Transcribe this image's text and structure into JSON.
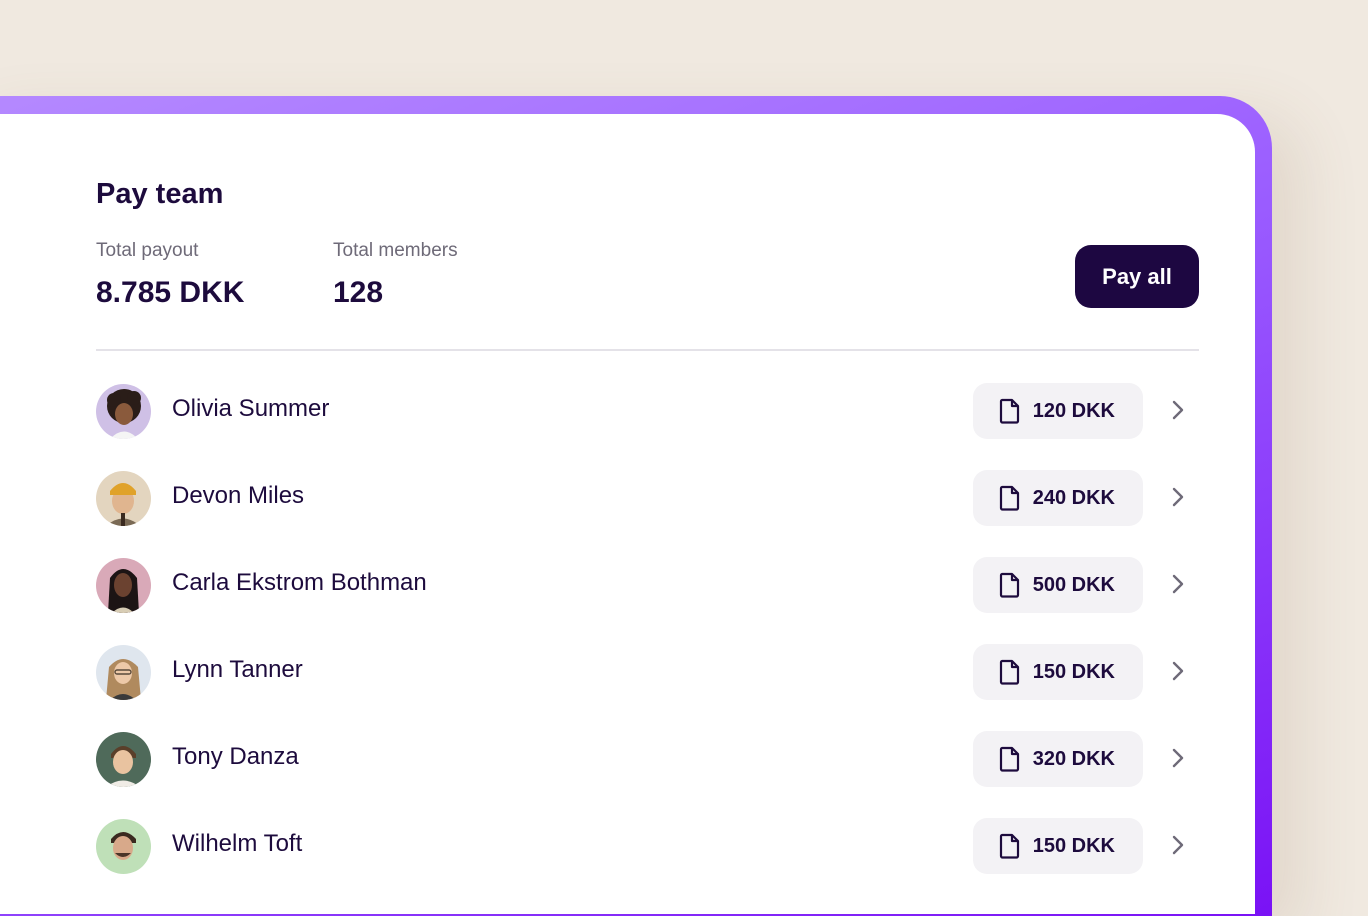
{
  "header": {
    "title": "Pay team",
    "pay_all_label": "Pay all"
  },
  "stats": {
    "total_payout_label": "Total payout",
    "total_payout_value": "8.785 DKK",
    "total_members_label": "Total members",
    "total_members_value": "128"
  },
  "members": [
    {
      "name": "Olivia Summer",
      "amount": "120 DKK"
    },
    {
      "name": "Devon Miles",
      "amount": "240 DKK"
    },
    {
      "name": "Carla Ekstrom Bothman",
      "amount": "500 DKK"
    },
    {
      "name": "Lynn Tanner",
      "amount": "150 DKK"
    },
    {
      "name": "Tony Danza",
      "amount": "320 DKK"
    },
    {
      "name": "Wilhelm Toft",
      "amount": "150 DKK"
    }
  ],
  "icons": {
    "amount": "document-icon",
    "row_action": "chevron-right-icon"
  },
  "colors": {
    "accent_purple": "#9a5cff",
    "primary_dark": "#1d0741",
    "background": "#f0e9e0"
  }
}
